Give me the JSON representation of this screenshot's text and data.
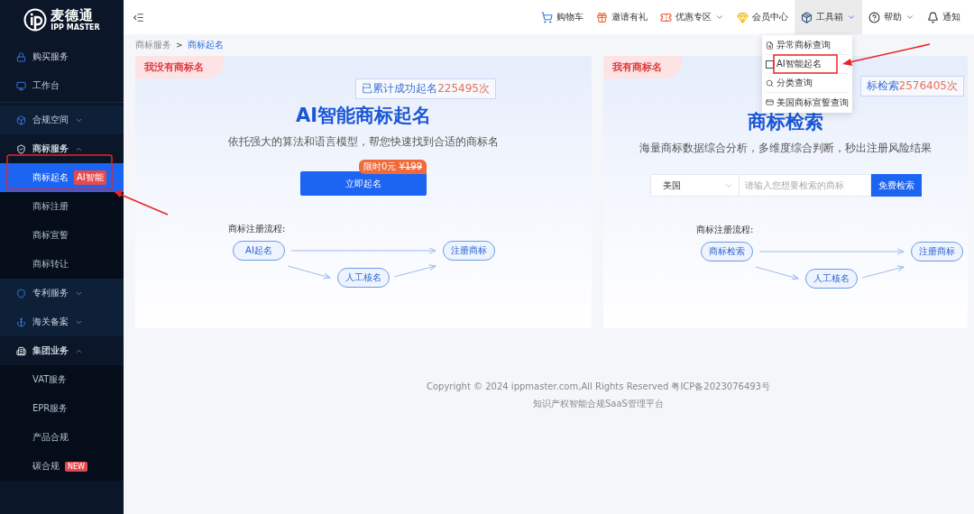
{
  "brand": {
    "name": "麦德通",
    "sub": "IPP MASTER"
  },
  "sidebar": {
    "items": [
      {
        "kind": "link",
        "label": "购买服务"
      },
      {
        "kind": "link",
        "label": "工作台"
      },
      {
        "kind": "divider"
      },
      {
        "kind": "group",
        "label": "合规空间",
        "expanded": false
      },
      {
        "kind": "group",
        "label": "商标服务",
        "expanded": true,
        "children": [
          {
            "label": "商标起名",
            "selected": true,
            "badge": "AI智能"
          },
          {
            "label": "商标注册",
            "selected": false
          },
          {
            "label": "商标宣誓",
            "selected": false
          },
          {
            "label": "商标转让",
            "selected": false
          }
        ]
      },
      {
        "kind": "group",
        "label": "专利服务",
        "expanded": false
      },
      {
        "kind": "group",
        "label": "海关备案",
        "expanded": false
      },
      {
        "kind": "group",
        "label": "集团业务",
        "expanded": true,
        "children": [
          {
            "label": "VAT服务",
            "selected": false
          },
          {
            "label": "EPR服务",
            "selected": false
          },
          {
            "label": "产品合规",
            "selected": false
          },
          {
            "label": "碳合规",
            "selected": false,
            "badge": "NEW"
          }
        ]
      }
    ]
  },
  "header": {
    "nav": [
      {
        "label": "购物车",
        "caret": false,
        "selected": false
      },
      {
        "label": "邀请有礼",
        "caret": false,
        "selected": false
      },
      {
        "label": "优惠专区",
        "caret": true,
        "selected": false
      },
      {
        "label": "会员中心",
        "caret": false,
        "selected": false
      },
      {
        "label": "工具箱",
        "caret": true,
        "selected": true
      },
      {
        "label": "帮助",
        "caret": true,
        "selected": false
      },
      {
        "label": "通知",
        "caret": false,
        "selected": false
      }
    ],
    "dropdown": [
      "异常商标查询",
      "AI智能起名",
      "分类查询",
      "美国商标宣誓查询"
    ]
  },
  "breadcrumb": {
    "separator": ">",
    "items": [
      {
        "label": "商标服务",
        "selected": false
      },
      {
        "label": "商标起名",
        "selected": true
      }
    ]
  },
  "cards": [
    {
      "kind": "naming",
      "tab": "我没有商标名",
      "counter": {
        "text": "已累计成功起名",
        "number": "225495次"
      },
      "title": "AI智能商标起名",
      "subtitle": "依托强大的算法和语言模型，帮您快速找到合适的商标名",
      "button": "立即起名",
      "ribbon": {
        "text": "限时0元",
        "old_price": "¥199"
      },
      "flow": {
        "label": "商标注册流程:",
        "start": "AI起名",
        "middle": "人工核名",
        "end": "注册商标"
      }
    },
    {
      "kind": "search",
      "tab": "我有商标名",
      "counter": {
        "text": "标检索",
        "number": "2576405次"
      },
      "title": "商标检索",
      "subtitle": "海量商标数据综合分析，多维度综合判断，秒出注册风险结果",
      "select": "美国",
      "placeholder": "请输入您想要检索的商标",
      "button": "免费检索",
      "flow": {
        "label": "商标注册流程:",
        "start": "商标检索",
        "middle": "人工核名",
        "end": "注册商标"
      }
    }
  ],
  "footer": [
    "Copyright © 2024 ippmaster.com,All Rights Reserved 粤ICP备2023076493号",
    "知识产权智能合规SaaS管理平台"
  ]
}
